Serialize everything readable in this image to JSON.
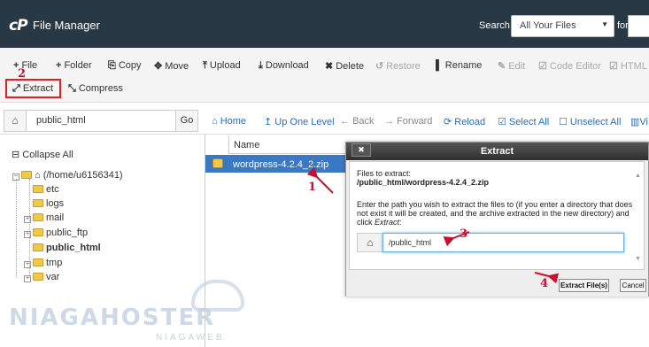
{
  "header": {
    "app_title": "File Manager",
    "logo_text": "cP",
    "search_label": "Search",
    "search_scope": "All Your Files",
    "for_label": "for"
  },
  "toolbar": {
    "file": "File",
    "folder": "Folder",
    "copy": "Copy",
    "move": "Move",
    "upload": "Upload",
    "download": "Download",
    "delete": "Delete",
    "restore": "Restore",
    "rename": "Rename",
    "edit": "Edit",
    "code_editor": "Code Editor",
    "html_editor": "HTML E",
    "extract": "Extract",
    "compress": "Compress"
  },
  "path_bar": {
    "path": "public_html",
    "go": "Go"
  },
  "nav": {
    "home": "Home",
    "up_one_level": "Up One Level",
    "back": "Back",
    "forward": "Forward",
    "reload": "Reload",
    "select_all": "Select All",
    "unselect_all": "Unselect All",
    "view": "Vi"
  },
  "tree": {
    "collapse_all": "Collapse All",
    "root": "(/home/u6156341)",
    "items": [
      "etc",
      "logs",
      "mail",
      "public_ftp",
      "public_html",
      "tmp",
      "var"
    ]
  },
  "file_list": {
    "column_name": "Name",
    "files": [
      {
        "name": "wordpress-4.2.4_2.zip",
        "selected": true
      }
    ]
  },
  "dialog": {
    "title": "Extract",
    "files_label": "Files to extract:",
    "file_path": "/public_html/wordpress-4.2.4_2.zip",
    "instructions_1": "Enter the path you wish to extract the files to (if you enter a directory that does",
    "instructions_2": "not exist it will be created, and the archive extracted in the new directory) and",
    "instructions_3": "click",
    "instructions_em": "Extract",
    "instructions_end": ":",
    "path_value": "/public_html",
    "extract_button": "Extract File(s)",
    "cancel_button": "Cancel"
  },
  "annotations": {
    "step_1": "1",
    "step_2": "2",
    "step_3": "3",
    "step_4": "4",
    "color": "#c8102e"
  },
  "watermark": {
    "brand": "NIAGAHOSTER",
    "sub": "NIAGAWEB"
  },
  "colors": {
    "header_bg": "#283845",
    "link_blue": "#2a6db5",
    "selection_blue": "#3b78c4"
  }
}
